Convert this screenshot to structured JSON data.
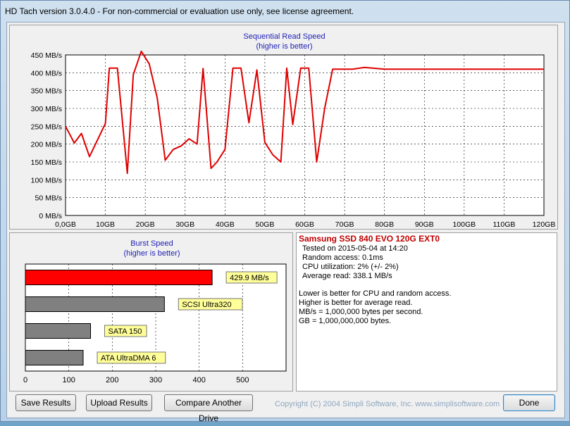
{
  "window": {
    "title": "HD Tach version 3.0.4.0  - For non-commercial or evaluation use only, see license agreement."
  },
  "read_chart": {
    "title": "Sequential Read Speed",
    "subtitle": "(higher is better)",
    "y_ticks": [
      "450 MB/s",
      "400 MB/s",
      "350 MB/s",
      "300 MB/s",
      "250 MB/s",
      "200 MB/s",
      "150 MB/s",
      "100 MB/s",
      "50 MB/s",
      "0 MB/s"
    ],
    "x_ticks": [
      "0,0GB",
      "10GB",
      "20GB",
      "30GB",
      "40GB",
      "50GB",
      "60GB",
      "70GB",
      "80GB",
      "90GB",
      "100GB",
      "110GB",
      "120GB"
    ],
    "line_color": "#e00000"
  },
  "burst_chart": {
    "title": "Burst Speed",
    "subtitle": "(higher is better)",
    "x_ticks": [
      "0",
      "100",
      "200",
      "300",
      "400",
      "500"
    ],
    "bars": [
      {
        "label": "429.9 MB/s",
        "value": 429.9,
        "color": "#ff0000"
      },
      {
        "label": "SCSI Ultra320",
        "value": 320,
        "color": "#808080"
      },
      {
        "label": "SATA 150",
        "value": 150,
        "color": "#808080"
      },
      {
        "label": "ATA UltraDMA 6",
        "value": 133,
        "color": "#808080"
      }
    ]
  },
  "info": {
    "drive": "Samsung SSD 840 EVO 120G EXT0",
    "lines": [
      "Tested on 2015-05-04 at 14:20",
      "Random access: 0.1ms",
      "CPU utilization: 2% (+/- 2%)",
      "Average read: 338.1 MB/s"
    ],
    "notes": [
      "Lower is better for CPU and random access.",
      "Higher is better for average read.",
      "MB/s = 1,000,000 bytes per second.",
      "GB = 1,000,000,000 bytes."
    ]
  },
  "buttons": {
    "save": "Save Results",
    "upload": "Upload Results",
    "compare": "Compare Another Drive",
    "done": "Done"
  },
  "copyright": "Copyright (C) 2004 Simpli Software, Inc. www.simplisoftware.com",
  "chart_data": [
    {
      "type": "line",
      "title": "Sequential Read Speed",
      "subtitle": "(higher is better)",
      "xlabel": "",
      "ylabel": "",
      "xlim": [
        0,
        120
      ],
      "ylim": [
        0,
        450
      ],
      "grid": true,
      "series": [
        {
          "x": [
            0,
            2.2,
            4,
            6,
            10,
            11,
            13,
            15.5,
            17,
            19,
            21,
            23,
            25,
            27,
            29,
            31,
            33,
            34.5,
            36.5,
            38,
            40,
            42,
            44,
            46,
            48,
            50,
            52,
            54,
            55.5,
            57,
            59,
            61,
            63,
            65,
            67,
            70,
            72,
            75,
            78,
            80,
            85,
            90,
            95,
            100,
            105,
            110,
            115,
            120
          ],
          "y": [
            250,
            203,
            230,
            165,
            258,
            413,
            413,
            118,
            395,
            460,
            425,
            330,
            155,
            185,
            195,
            215,
            200,
            412,
            132,
            150,
            185,
            413,
            413,
            260,
            408,
            205,
            170,
            150,
            413,
            255,
            413,
            413,
            150,
            300,
            410,
            410,
            410,
            415,
            412,
            410,
            410,
            410,
            410,
            410,
            410,
            410,
            410,
            410
          ]
        }
      ]
    },
    {
      "type": "bar",
      "title": "Burst Speed",
      "subtitle": "(higher is better)",
      "categories": [
        "429.9 MB/s",
        "SCSI Ultra320",
        "SATA 150",
        "ATA UltraDMA 6"
      ],
      "values": [
        429.9,
        320,
        150,
        133
      ],
      "xlim": [
        0,
        600
      ],
      "grid": true
    }
  ]
}
